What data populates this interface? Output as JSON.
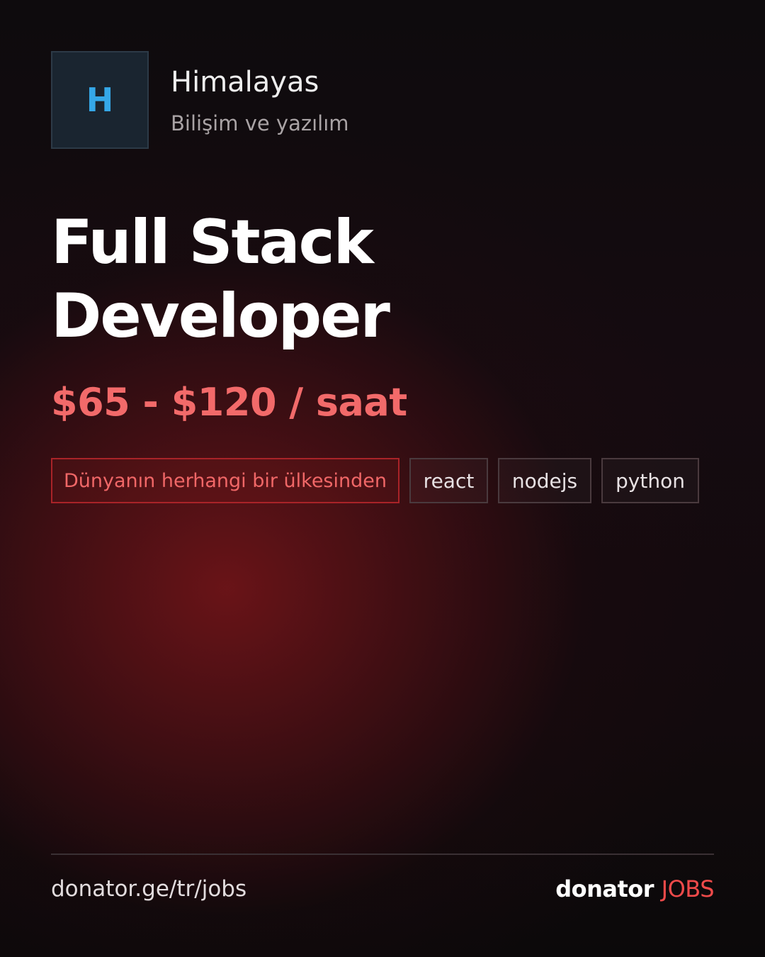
{
  "company": {
    "logo_letter": "H",
    "name": "Himalayas",
    "industry": "Bilişim ve yazılım",
    "logo_color": "#35a8e8"
  },
  "job": {
    "title_line1": "Full Stack",
    "title_line2": "Developer",
    "salary": "$65 - $120 / saat"
  },
  "tags": {
    "location": "Dünyanın herhangi bir ülkesinden",
    "skills": [
      "react",
      "nodejs",
      "python"
    ]
  },
  "footer": {
    "url": "donator.ge/tr/jobs",
    "brand_part1": "donator",
    "brand_part2": "JOBS"
  },
  "colors": {
    "accent": "#f26a6a",
    "brand_red": "#ef4a4a",
    "location_border": "#a92328"
  }
}
